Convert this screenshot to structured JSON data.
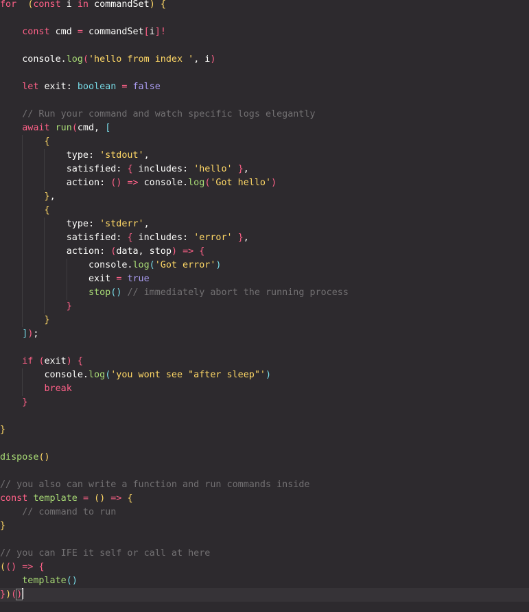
{
  "editor": {
    "lines": [
      [
        [
          "kw",
          "for"
        ],
        [
          "",
          "  "
        ],
        [
          "b1",
          "("
        ],
        [
          "kw",
          "const"
        ],
        [
          "",
          " i "
        ],
        [
          "kw",
          "in"
        ],
        [
          "",
          " commandSet"
        ],
        [
          "b1",
          ")"
        ],
        [
          "",
          " "
        ],
        [
          "b1",
          "{"
        ]
      ],
      [],
      [
        [
          "",
          "    "
        ],
        [
          "kw",
          "const"
        ],
        [
          "",
          " cmd "
        ],
        [
          "kw",
          "="
        ],
        [
          "",
          " commandSet"
        ],
        [
          "b2",
          "["
        ],
        [
          "",
          "i"
        ],
        [
          "b2",
          "]"
        ],
        [
          "kw",
          "!"
        ]
      ],
      [],
      [
        [
          "",
          "    console."
        ],
        [
          "fn",
          "log"
        ],
        [
          "b2",
          "("
        ],
        [
          "str",
          "'hello from index '"
        ],
        [
          "",
          ", i"
        ],
        [
          "b2",
          ")"
        ]
      ],
      [],
      [
        [
          "",
          "    "
        ],
        [
          "kw",
          "let"
        ],
        [
          "",
          " exit: "
        ],
        [
          "ty",
          "boolean"
        ],
        [
          "",
          " "
        ],
        [
          "kw",
          "="
        ],
        [
          "",
          " "
        ],
        [
          "num",
          "false"
        ]
      ],
      [],
      [
        [
          "",
          "    "
        ],
        [
          "cm",
          "// Run your command and watch specific logs elegantly"
        ]
      ],
      [
        [
          "",
          "    "
        ],
        [
          "kw",
          "await"
        ],
        [
          "",
          " "
        ],
        [
          "fn",
          "run"
        ],
        [
          "b2",
          "("
        ],
        [
          "",
          "cmd, "
        ],
        [
          "b3",
          "["
        ]
      ],
      [
        [
          "",
          "        "
        ],
        [
          "b1",
          "{"
        ]
      ],
      [
        [
          "",
          "            type: "
        ],
        [
          "str",
          "'stdout'"
        ],
        [
          "",
          ","
        ]
      ],
      [
        [
          "",
          "            satisfied: "
        ],
        [
          "b2",
          "{"
        ],
        [
          "",
          " includes: "
        ],
        [
          "str",
          "'hello'"
        ],
        [
          "",
          " "
        ],
        [
          "b2",
          "}"
        ],
        [
          "",
          ","
        ]
      ],
      [
        [
          "",
          "            action: "
        ],
        [
          "b2",
          "("
        ],
        [
          "b2",
          ")"
        ],
        [
          "",
          " "
        ],
        [
          "kw",
          "=>"
        ],
        [
          "",
          " console."
        ],
        [
          "fn",
          "log"
        ],
        [
          "b2",
          "("
        ],
        [
          "str",
          "'Got hello'"
        ],
        [
          "b2",
          ")"
        ]
      ],
      [
        [
          "",
          "        "
        ],
        [
          "b1",
          "}"
        ],
        [
          "",
          ","
        ]
      ],
      [
        [
          "",
          "        "
        ],
        [
          "b1",
          "{"
        ]
      ],
      [
        [
          "",
          "            type: "
        ],
        [
          "str",
          "'stderr'"
        ],
        [
          "",
          ","
        ]
      ],
      [
        [
          "",
          "            satisfied: "
        ],
        [
          "b2",
          "{"
        ],
        [
          "",
          " includes: "
        ],
        [
          "str",
          "'error'"
        ],
        [
          "",
          " "
        ],
        [
          "b2",
          "}"
        ],
        [
          "",
          ","
        ]
      ],
      [
        [
          "",
          "            action: "
        ],
        [
          "b2",
          "("
        ],
        [
          "",
          "data, stop"
        ],
        [
          "b2",
          ")"
        ],
        [
          "",
          " "
        ],
        [
          "kw",
          "=>"
        ],
        [
          "",
          " "
        ],
        [
          "b2",
          "{"
        ]
      ],
      [
        [
          "",
          "                console."
        ],
        [
          "fn",
          "log"
        ],
        [
          "b3",
          "("
        ],
        [
          "str",
          "'Got error'"
        ],
        [
          "b3",
          ")"
        ]
      ],
      [
        [
          "",
          "                exit "
        ],
        [
          "kw",
          "="
        ],
        [
          "",
          " "
        ],
        [
          "num",
          "true"
        ]
      ],
      [
        [
          "",
          "                "
        ],
        [
          "fn",
          "stop"
        ],
        [
          "b3",
          "("
        ],
        [
          "b3",
          ")"
        ],
        [
          "",
          " "
        ],
        [
          "cm",
          "// immediately abort the running process"
        ]
      ],
      [
        [
          "",
          "            "
        ],
        [
          "b2",
          "}"
        ]
      ],
      [
        [
          "",
          "        "
        ],
        [
          "b1",
          "}"
        ]
      ],
      [
        [
          "",
          "    "
        ],
        [
          "b3",
          "]"
        ],
        [
          "b2",
          ")"
        ],
        [
          "",
          ";"
        ]
      ],
      [],
      [
        [
          "",
          "    "
        ],
        [
          "kw",
          "if"
        ],
        [
          "",
          " "
        ],
        [
          "b2",
          "("
        ],
        [
          "",
          "exit"
        ],
        [
          "b2",
          ")"
        ],
        [
          "",
          " "
        ],
        [
          "b2",
          "{"
        ]
      ],
      [
        [
          "",
          "        console."
        ],
        [
          "fn",
          "log"
        ],
        [
          "b3",
          "("
        ],
        [
          "str",
          "'you wont see \"after sleep\"'"
        ],
        [
          "b3",
          ")"
        ]
      ],
      [
        [
          "",
          "        "
        ],
        [
          "kw",
          "break"
        ]
      ],
      [
        [
          "",
          "    "
        ],
        [
          "b2",
          "}"
        ]
      ],
      [],
      [
        [
          "b1",
          "}"
        ]
      ],
      [],
      [
        [
          "fn",
          "dispose"
        ],
        [
          "b1",
          "("
        ],
        [
          "b1",
          ")"
        ]
      ],
      [],
      [
        [
          "cm",
          "// you also can write a function and run commands inside"
        ]
      ],
      [
        [
          "kw",
          "const"
        ],
        [
          "",
          " "
        ],
        [
          "fn",
          "template"
        ],
        [
          "",
          " "
        ],
        [
          "kw",
          "="
        ],
        [
          "",
          " "
        ],
        [
          "b1",
          "("
        ],
        [
          "b1",
          ")"
        ],
        [
          "",
          " "
        ],
        [
          "kw",
          "=>"
        ],
        [
          "",
          " "
        ],
        [
          "b1",
          "{"
        ]
      ],
      [
        [
          "",
          "    "
        ],
        [
          "cm",
          "// command to run"
        ]
      ],
      [
        [
          "b1",
          "}"
        ]
      ],
      [],
      [
        [
          "cm",
          "// you can IFE it self or call at here"
        ]
      ],
      [
        [
          "b1",
          "("
        ],
        [
          "b2",
          "("
        ],
        [
          "b2",
          ")"
        ],
        [
          "",
          " "
        ],
        [
          "kw",
          "=>"
        ],
        [
          "",
          " "
        ],
        [
          "b2",
          "{"
        ]
      ],
      [
        [
          "",
          "    "
        ],
        [
          "fn",
          "template"
        ],
        [
          "b3",
          "("
        ],
        [
          "b3",
          ")"
        ]
      ],
      [
        [
          "b2",
          "}"
        ],
        [
          "b1",
          ")"
        ],
        [
          "b2",
          "("
        ],
        [
          "b2",
          ")"
        ]
      ]
    ],
    "current_line": 43
  }
}
